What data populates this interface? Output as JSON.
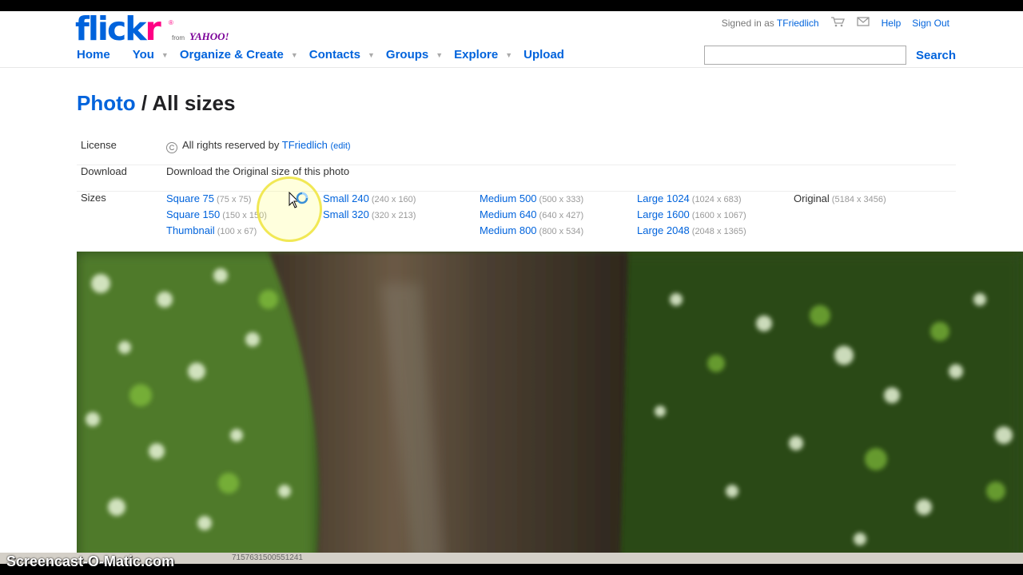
{
  "header": {
    "logo_text_1": "flick",
    "logo_text_2": "r",
    "logo_reg": "®",
    "logo_from": "from",
    "logo_yahoo": "YAHOO!",
    "signed_in_prefix": "Signed in as",
    "username": "TFriedlich",
    "cart_icon": "shopping-cart-icon",
    "mail_icon": "mail-icon",
    "help": "Help",
    "sign_out": "Sign Out"
  },
  "nav": {
    "items": [
      {
        "label": "Home",
        "has_caret": false
      },
      {
        "label": "You",
        "has_caret": true
      },
      {
        "label": "Organize & Create",
        "has_caret": true
      },
      {
        "label": "Contacts",
        "has_caret": true
      },
      {
        "label": "Groups",
        "has_caret": true
      },
      {
        "label": "Explore",
        "has_caret": true
      },
      {
        "label": "Upload",
        "has_caret": false
      }
    ],
    "search_placeholder": "",
    "search_value": "",
    "search_button": "Search"
  },
  "page": {
    "title_link": "Photo",
    "title_sep": "/",
    "title_rest": "All sizes"
  },
  "info": {
    "license_label": "License",
    "license_icon": "copyright-icon",
    "license_text": "All rights reserved by",
    "license_owner": "TFriedlich",
    "license_edit": "(edit)",
    "download_label": "Download",
    "download_link": "Download the Original size of this photo",
    "sizes_label": "Sizes"
  },
  "sizes": [
    [
      {
        "name": "Square 75",
        "dims": "(75 x 75)"
      },
      {
        "name": "Square 150",
        "dims": "(150 x 150)"
      },
      {
        "name": "Thumbnail",
        "dims": "(100 x 67)"
      }
    ],
    [
      {
        "name": "Small 240",
        "dims": "(240 x 160)"
      },
      {
        "name": "Small 320",
        "dims": "(320 x 213)"
      }
    ],
    [
      {
        "name": "Medium 500",
        "dims": "(500 x 333)"
      },
      {
        "name": "Medium 640",
        "dims": "(640 x 427)"
      },
      {
        "name": "Medium 800",
        "dims": "(800 x 534)"
      }
    ],
    [
      {
        "name": "Large 1024",
        "dims": "(1024 x 683)"
      },
      {
        "name": "Large 1600",
        "dims": "(1600 x 1067)"
      },
      {
        "name": "Large 2048",
        "dims": "(2048 x 1365)"
      }
    ],
    [
      {
        "name": "Original",
        "dims": "(5184 x 3456)",
        "current": true
      }
    ]
  ],
  "photo": {
    "alt": "",
    "colors": {
      "foliage_dark": "#1f3d12",
      "foliage_bright": "#7fbf3a",
      "trunk": "#5a4a38",
      "highlight": "#e8f5d8"
    }
  },
  "overlay": {
    "watermark": "Screencast-O-Matic.com",
    "status_url": "71576315005512​41"
  },
  "colors": {
    "link_blue": "#0063dc",
    "flickr_pink": "#ff0084",
    "yahoo_purple": "#7b0099"
  }
}
